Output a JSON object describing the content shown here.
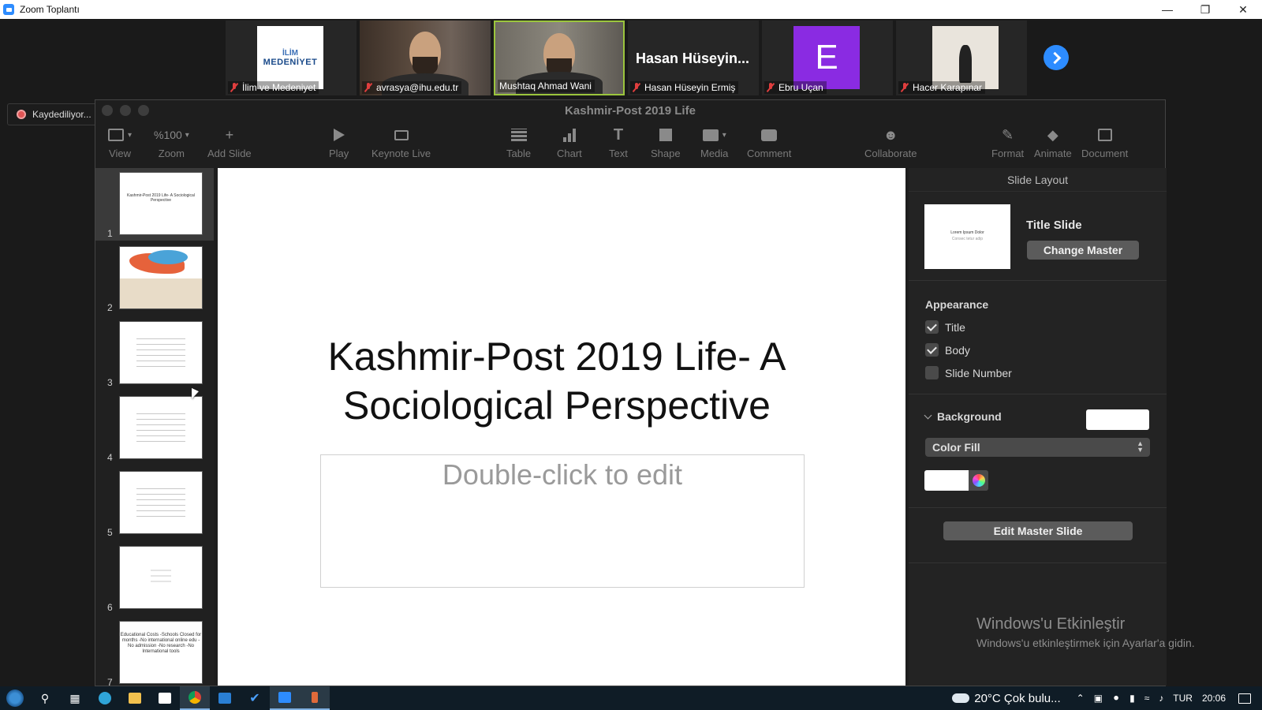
{
  "window": {
    "title": "Zoom Toplantı"
  },
  "participants": [
    {
      "name": "İlim ve Medeniyet",
      "logo_line1": "İLİM",
      "logo_line2": "MEDENİYET"
    },
    {
      "name": "avrasya@ihu.edu.tr"
    },
    {
      "name": "Mushtaq Ahmad Wani",
      "active_speaker": true
    },
    {
      "name": "Hasan Hüseyin Ermiş",
      "display_name": "Hasan Hüseyin..."
    },
    {
      "name": "Ebru Uçan",
      "initial": "E"
    },
    {
      "name": "Hacer Karapınar"
    }
  ],
  "recording": {
    "label": "Kaydediliyor..."
  },
  "keynote": {
    "title": "Kashmir-Post 2019 Life",
    "toolbar": {
      "view": "View",
      "zoom_value": "%100",
      "zoom": "Zoom",
      "add_slide": "Add Slide",
      "play": "Play",
      "keynote_live": "Keynote Live",
      "table": "Table",
      "chart": "Chart",
      "text": "Text",
      "shape": "Shape",
      "media": "Media",
      "comment": "Comment",
      "collaborate": "Collaborate",
      "format": "Format",
      "animate": "Animate",
      "document": "Document"
    },
    "slides": [
      {
        "num": "1",
        "text": "Kashmir-Post 2019 Life- A Sociological Perspective"
      },
      {
        "num": "2"
      },
      {
        "num": "3"
      },
      {
        "num": "4"
      },
      {
        "num": "5"
      },
      {
        "num": "6"
      },
      {
        "num": "7",
        "text": "Educational Costs -Schools Closed for months -No international online edu -No admission -No research -No International tools"
      }
    ],
    "canvas": {
      "title": "Kashmir-Post 2019 Life- A Sociological Perspective",
      "subtitle_placeholder": "Double-click to edit"
    },
    "inspector": {
      "header": "Slide Layout",
      "layout_thumb_title": "Lorem Ipsum Dolor",
      "layout_thumb_sub": "Consec tetur adip",
      "layout_name": "Title Slide",
      "change_master": "Change Master",
      "appearance": "Appearance",
      "checks": [
        {
          "label": "Title",
          "checked": true
        },
        {
          "label": "Body",
          "checked": true
        },
        {
          "label": "Slide Number",
          "checked": false
        }
      ],
      "background": "Background",
      "fill_type": "Color Fill",
      "edit_master": "Edit Master Slide"
    }
  },
  "watermark": {
    "line1": "Windows'u Etkinleştir",
    "line2": "Windows'u etkinleştirmek için Ayarlar'a gidin."
  },
  "taskbar": {
    "weather": "20°C  Çok bulu...",
    "language": "TUR",
    "time": "20:06"
  },
  "colors": {
    "zoom_blue": "#2d8cff",
    "active_border": "#9bc53d",
    "avatar_purple": "#8a2be2"
  }
}
